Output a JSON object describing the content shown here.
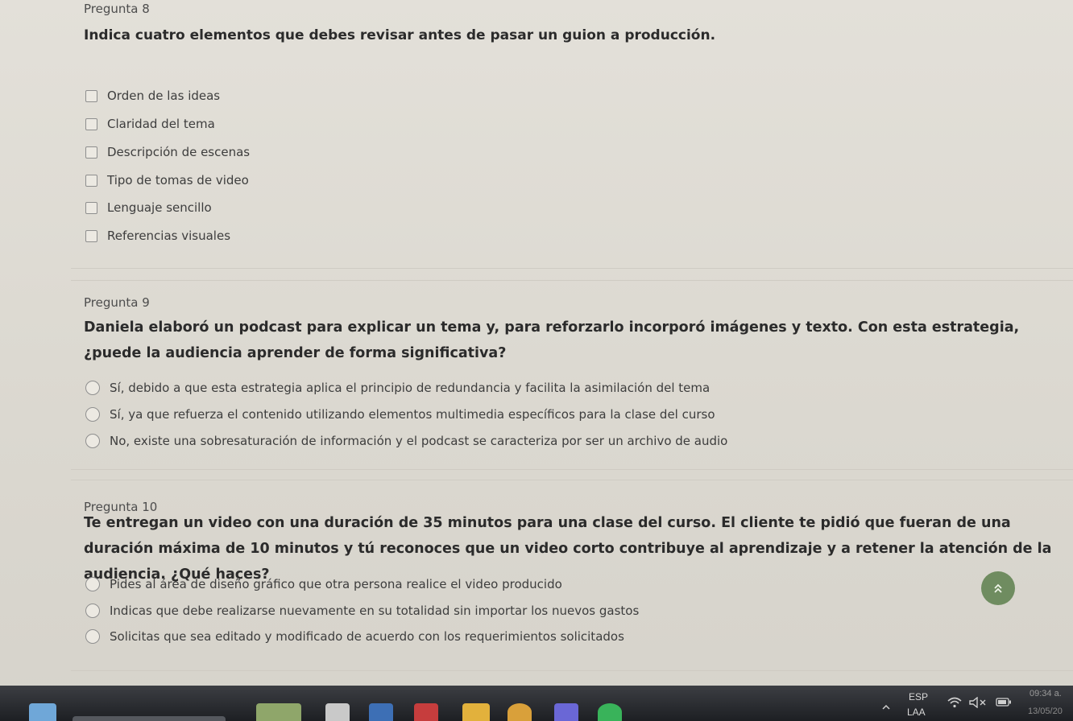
{
  "q8": {
    "number": "Pregunta 8",
    "text": "Indica cuatro elementos que debes revisar antes de pasar un guion a producción.",
    "options": [
      "Orden de las ideas",
      "Claridad del tema",
      "Descripción de escenas",
      "Tipo de tomas de video",
      "Lenguaje sencillo",
      "Referencias visuales"
    ]
  },
  "q9": {
    "number": "Pregunta 9",
    "text": "Daniela elaboró un podcast para explicar un tema y, para reforzarlo incorporó imágenes y texto. Con esta estrategia, ¿puede la audiencia aprender de forma significativa?",
    "options": [
      "Sí, debido a que esta estrategia aplica el principio de redundancia y facilita la asimilación del tema",
      "Sí, ya que refuerza el contenido utilizando elementos multimedia específicos para la clase del curso",
      "No, existe una sobresaturación de información y el podcast se caracteriza por ser un archivo de audio"
    ]
  },
  "q10": {
    "number": "Pregunta 10",
    "text": "Te entregan un video con una duración de 35 minutos para una clase del curso. El cliente te pidió que fueran de una duración máxima de 10 minutos y tú reconoces que un video corto contribuye al aprendizaje y a retener la atención de la audiencia. ¿Qué haces?",
    "options": [
      "Pides al área de diseño gráfico que otra persona realice el video producido",
      "Indicas que debe realizarse nuevamente en su totalidad sin importar los nuevos gastos",
      "Solicitas que sea editado y modificado de acuerdo con los requerimientos solicitados"
    ]
  },
  "scroll_top_icon": "double-chevron-up-icon",
  "taskbar": {
    "lang_primary": "ESP",
    "lang_secondary": "LAA",
    "time": "09:34 a.",
    "date": "13/05/20"
  },
  "colors": {
    "fab": "#6f8c60",
    "taskbar": "#1d1f23",
    "background": "#dedad2"
  }
}
